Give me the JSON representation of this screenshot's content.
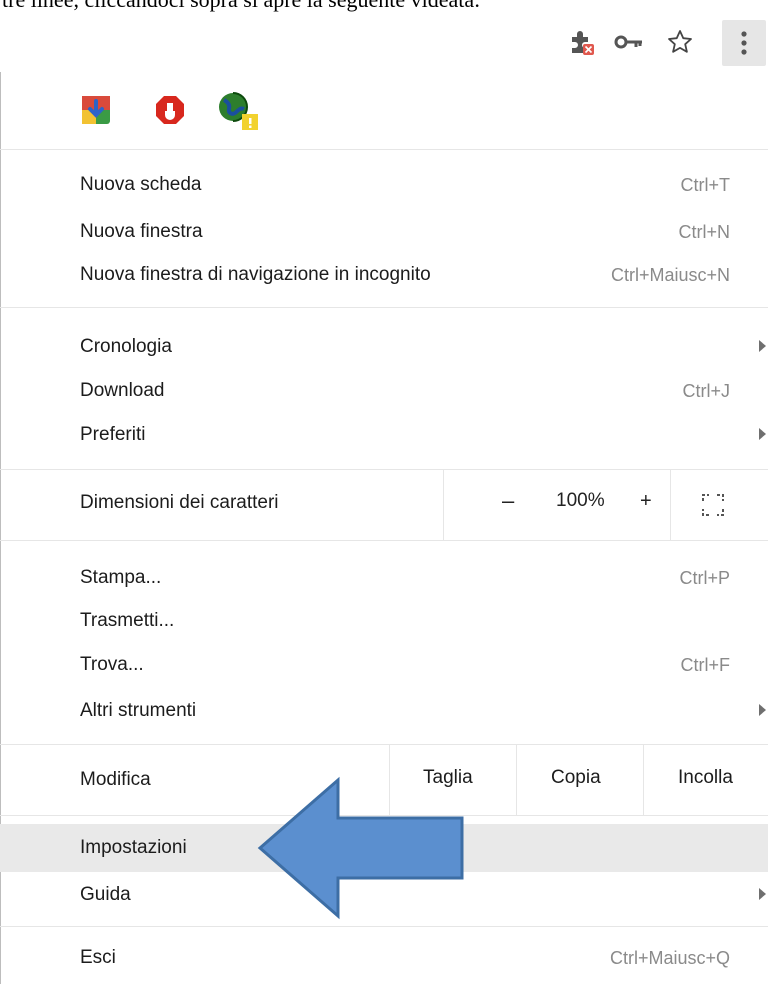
{
  "document": {
    "caption": "tre linee, cliccandoci sopra si apre la seguente videata:"
  },
  "toolbar": {
    "icons": [
      "puzzle-blocked-icon",
      "key-icon",
      "star-icon",
      "kebab-menu-icon"
    ]
  },
  "extensions": [
    "download-extension-icon",
    "stop-extension-icon",
    "globe-extension-icon"
  ],
  "menu": {
    "group1": [
      {
        "label": "Nuova scheda",
        "shortcut": "Ctrl+T"
      },
      {
        "label": "Nuova finestra",
        "shortcut": "Ctrl+N"
      },
      {
        "label": "Nuova finestra di navigazione in incognito",
        "shortcut": "Ctrl+Maiusc+N"
      }
    ],
    "group2": [
      {
        "label": "Cronologia"
      },
      {
        "label": "Download",
        "shortcut": "Ctrl+J"
      },
      {
        "label": "Preferiti"
      }
    ],
    "zoom": {
      "label": "Dimensioni dei caratteri",
      "minus": "–",
      "value": "100%",
      "plus": "+"
    },
    "group3": [
      {
        "label": "Stampa...",
        "shortcut": "Ctrl+P"
      },
      {
        "label": "Trasmetti..."
      },
      {
        "label": "Trova...",
        "shortcut": "Ctrl+F"
      },
      {
        "label": "Altri strumenti"
      }
    ],
    "edit": {
      "label": "Modifica",
      "cut": "Taglia",
      "copy": "Copia",
      "paste": "Incolla"
    },
    "group4": [
      {
        "label": "Impostazioni"
      },
      {
        "label": "Guida"
      }
    ],
    "group5": [
      {
        "label": "Esci",
        "shortcut": "Ctrl+Maiusc+Q"
      }
    ]
  },
  "colors": {
    "highlight": "#e9e9e9",
    "arrow_fill": "#5b8fcf",
    "arrow_stroke": "#3d6ea5"
  }
}
